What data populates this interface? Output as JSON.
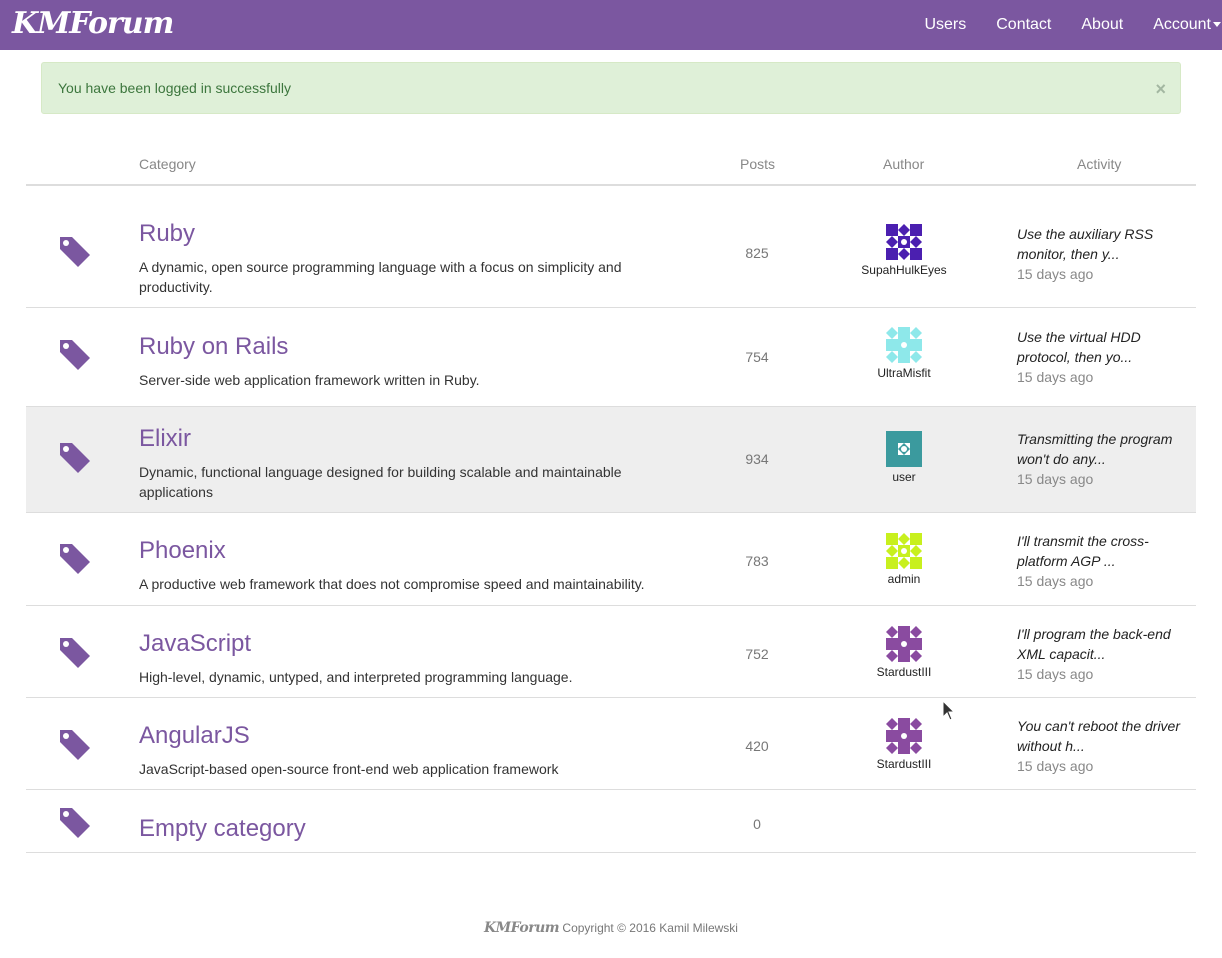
{
  "navbar": {
    "brand": "KMForum",
    "links": [
      "Users",
      "Contact",
      "About",
      "Account"
    ]
  },
  "alert": {
    "message": "You have been logged in successfully",
    "close": "×"
  },
  "table": {
    "headers": {
      "category": "Category",
      "posts": "Posts",
      "author": "Author",
      "activity": "Activity"
    },
    "rows": [
      {
        "title": "Ruby",
        "desc": "A dynamic, open source programming language with a focus on simplicity and productivity.",
        "posts": "825",
        "author": "SupahHulkEyes",
        "avatar_color": "#4b1fb0",
        "activity": "Use the auxiliary RSS monitor, then y...",
        "time": "15 days ago"
      },
      {
        "title": "Ruby on Rails",
        "desc": "Server-side web application framework written in Ruby.",
        "posts": "754",
        "author": "UltraMisfit",
        "avatar_color": "#8ee8ea",
        "activity": "Use the virtual HDD protocol, then yo...",
        "time": "15 days ago"
      },
      {
        "title": "Elixir",
        "desc": "Dynamic, functional language designed for building scalable and maintainable applications",
        "posts": "934",
        "author": "user",
        "avatar_color": "#3b9a9e",
        "activity": "Transmitting the program won't do any...",
        "time": "15 days ago"
      },
      {
        "title": "Phoenix",
        "desc": "A productive web framework that does not compromise speed and maintainability.",
        "posts": "783",
        "author": "admin",
        "avatar_color": "#c8f01e",
        "activity": "I'll transmit the cross-platform AGP ...",
        "time": "15 days ago"
      },
      {
        "title": "JavaScript",
        "desc": "High-level, dynamic, untyped, and interpreted programming language.",
        "posts": "752",
        "author": "StardustIII",
        "avatar_color": "#8a4ba0",
        "activity": "I'll program the back-end XML capacit...",
        "time": "15 days ago"
      },
      {
        "title": "AngularJS",
        "desc": "JavaScript-based open-source front-end web application framework",
        "posts": "420",
        "author": "StardustIII",
        "avatar_color": "#8a4ba0",
        "activity": "You can't reboot the driver without h...",
        "time": "15 days ago"
      },
      {
        "title": "Empty category",
        "desc": "",
        "posts": "0",
        "author": "",
        "avatar_color": "",
        "activity": "",
        "time": ""
      }
    ]
  },
  "footer": {
    "brand": "KMForum",
    "text": " Copyright © 2016 Kamil Milewski"
  },
  "colors": {
    "brand": "#7b57a0",
    "alert_bg": "#dff0d8",
    "alert_text": "#3c763d"
  },
  "icons": {
    "tag": "tag-icon",
    "close": "close-icon",
    "caret": "caret-down-icon",
    "cursor": "mouse-pointer-icon"
  }
}
